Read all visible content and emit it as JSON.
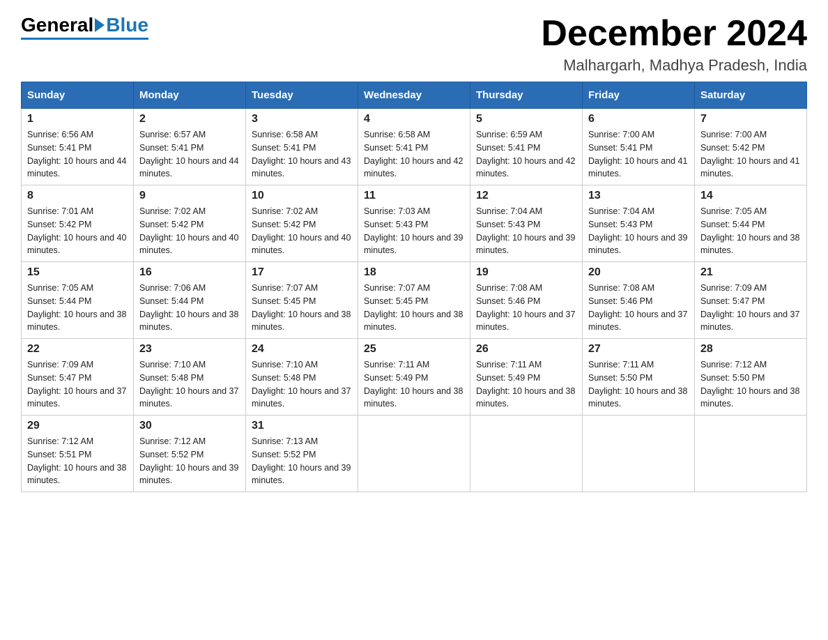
{
  "logo": {
    "general": "General",
    "blue": "Blue"
  },
  "title": "December 2024",
  "subtitle": "Malhargarh, Madhya Pradesh, India",
  "days_of_week": [
    "Sunday",
    "Monday",
    "Tuesday",
    "Wednesday",
    "Thursday",
    "Friday",
    "Saturday"
  ],
  "weeks": [
    [
      {
        "day": "1",
        "sunrise": "6:56 AM",
        "sunset": "5:41 PM",
        "daylight": "10 hours and 44 minutes."
      },
      {
        "day": "2",
        "sunrise": "6:57 AM",
        "sunset": "5:41 PM",
        "daylight": "10 hours and 44 minutes."
      },
      {
        "day": "3",
        "sunrise": "6:58 AM",
        "sunset": "5:41 PM",
        "daylight": "10 hours and 43 minutes."
      },
      {
        "day": "4",
        "sunrise": "6:58 AM",
        "sunset": "5:41 PM",
        "daylight": "10 hours and 42 minutes."
      },
      {
        "day": "5",
        "sunrise": "6:59 AM",
        "sunset": "5:41 PM",
        "daylight": "10 hours and 42 minutes."
      },
      {
        "day": "6",
        "sunrise": "7:00 AM",
        "sunset": "5:41 PM",
        "daylight": "10 hours and 41 minutes."
      },
      {
        "day": "7",
        "sunrise": "7:00 AM",
        "sunset": "5:42 PM",
        "daylight": "10 hours and 41 minutes."
      }
    ],
    [
      {
        "day": "8",
        "sunrise": "7:01 AM",
        "sunset": "5:42 PM",
        "daylight": "10 hours and 40 minutes."
      },
      {
        "day": "9",
        "sunrise": "7:02 AM",
        "sunset": "5:42 PM",
        "daylight": "10 hours and 40 minutes."
      },
      {
        "day": "10",
        "sunrise": "7:02 AM",
        "sunset": "5:42 PM",
        "daylight": "10 hours and 40 minutes."
      },
      {
        "day": "11",
        "sunrise": "7:03 AM",
        "sunset": "5:43 PM",
        "daylight": "10 hours and 39 minutes."
      },
      {
        "day": "12",
        "sunrise": "7:04 AM",
        "sunset": "5:43 PM",
        "daylight": "10 hours and 39 minutes."
      },
      {
        "day": "13",
        "sunrise": "7:04 AM",
        "sunset": "5:43 PM",
        "daylight": "10 hours and 39 minutes."
      },
      {
        "day": "14",
        "sunrise": "7:05 AM",
        "sunset": "5:44 PM",
        "daylight": "10 hours and 38 minutes."
      }
    ],
    [
      {
        "day": "15",
        "sunrise": "7:05 AM",
        "sunset": "5:44 PM",
        "daylight": "10 hours and 38 minutes."
      },
      {
        "day": "16",
        "sunrise": "7:06 AM",
        "sunset": "5:44 PM",
        "daylight": "10 hours and 38 minutes."
      },
      {
        "day": "17",
        "sunrise": "7:07 AM",
        "sunset": "5:45 PM",
        "daylight": "10 hours and 38 minutes."
      },
      {
        "day": "18",
        "sunrise": "7:07 AM",
        "sunset": "5:45 PM",
        "daylight": "10 hours and 38 minutes."
      },
      {
        "day": "19",
        "sunrise": "7:08 AM",
        "sunset": "5:46 PM",
        "daylight": "10 hours and 37 minutes."
      },
      {
        "day": "20",
        "sunrise": "7:08 AM",
        "sunset": "5:46 PM",
        "daylight": "10 hours and 37 minutes."
      },
      {
        "day": "21",
        "sunrise": "7:09 AM",
        "sunset": "5:47 PM",
        "daylight": "10 hours and 37 minutes."
      }
    ],
    [
      {
        "day": "22",
        "sunrise": "7:09 AM",
        "sunset": "5:47 PM",
        "daylight": "10 hours and 37 minutes."
      },
      {
        "day": "23",
        "sunrise": "7:10 AM",
        "sunset": "5:48 PM",
        "daylight": "10 hours and 37 minutes."
      },
      {
        "day": "24",
        "sunrise": "7:10 AM",
        "sunset": "5:48 PM",
        "daylight": "10 hours and 37 minutes."
      },
      {
        "day": "25",
        "sunrise": "7:11 AM",
        "sunset": "5:49 PM",
        "daylight": "10 hours and 38 minutes."
      },
      {
        "day": "26",
        "sunrise": "7:11 AM",
        "sunset": "5:49 PM",
        "daylight": "10 hours and 38 minutes."
      },
      {
        "day": "27",
        "sunrise": "7:11 AM",
        "sunset": "5:50 PM",
        "daylight": "10 hours and 38 minutes."
      },
      {
        "day": "28",
        "sunrise": "7:12 AM",
        "sunset": "5:50 PM",
        "daylight": "10 hours and 38 minutes."
      }
    ],
    [
      {
        "day": "29",
        "sunrise": "7:12 AM",
        "sunset": "5:51 PM",
        "daylight": "10 hours and 38 minutes."
      },
      {
        "day": "30",
        "sunrise": "7:12 AM",
        "sunset": "5:52 PM",
        "daylight": "10 hours and 39 minutes."
      },
      {
        "day": "31",
        "sunrise": "7:13 AM",
        "sunset": "5:52 PM",
        "daylight": "10 hours and 39 minutes."
      },
      null,
      null,
      null,
      null
    ]
  ],
  "labels": {
    "sunrise": "Sunrise:",
    "sunset": "Sunset:",
    "daylight": "Daylight:"
  }
}
